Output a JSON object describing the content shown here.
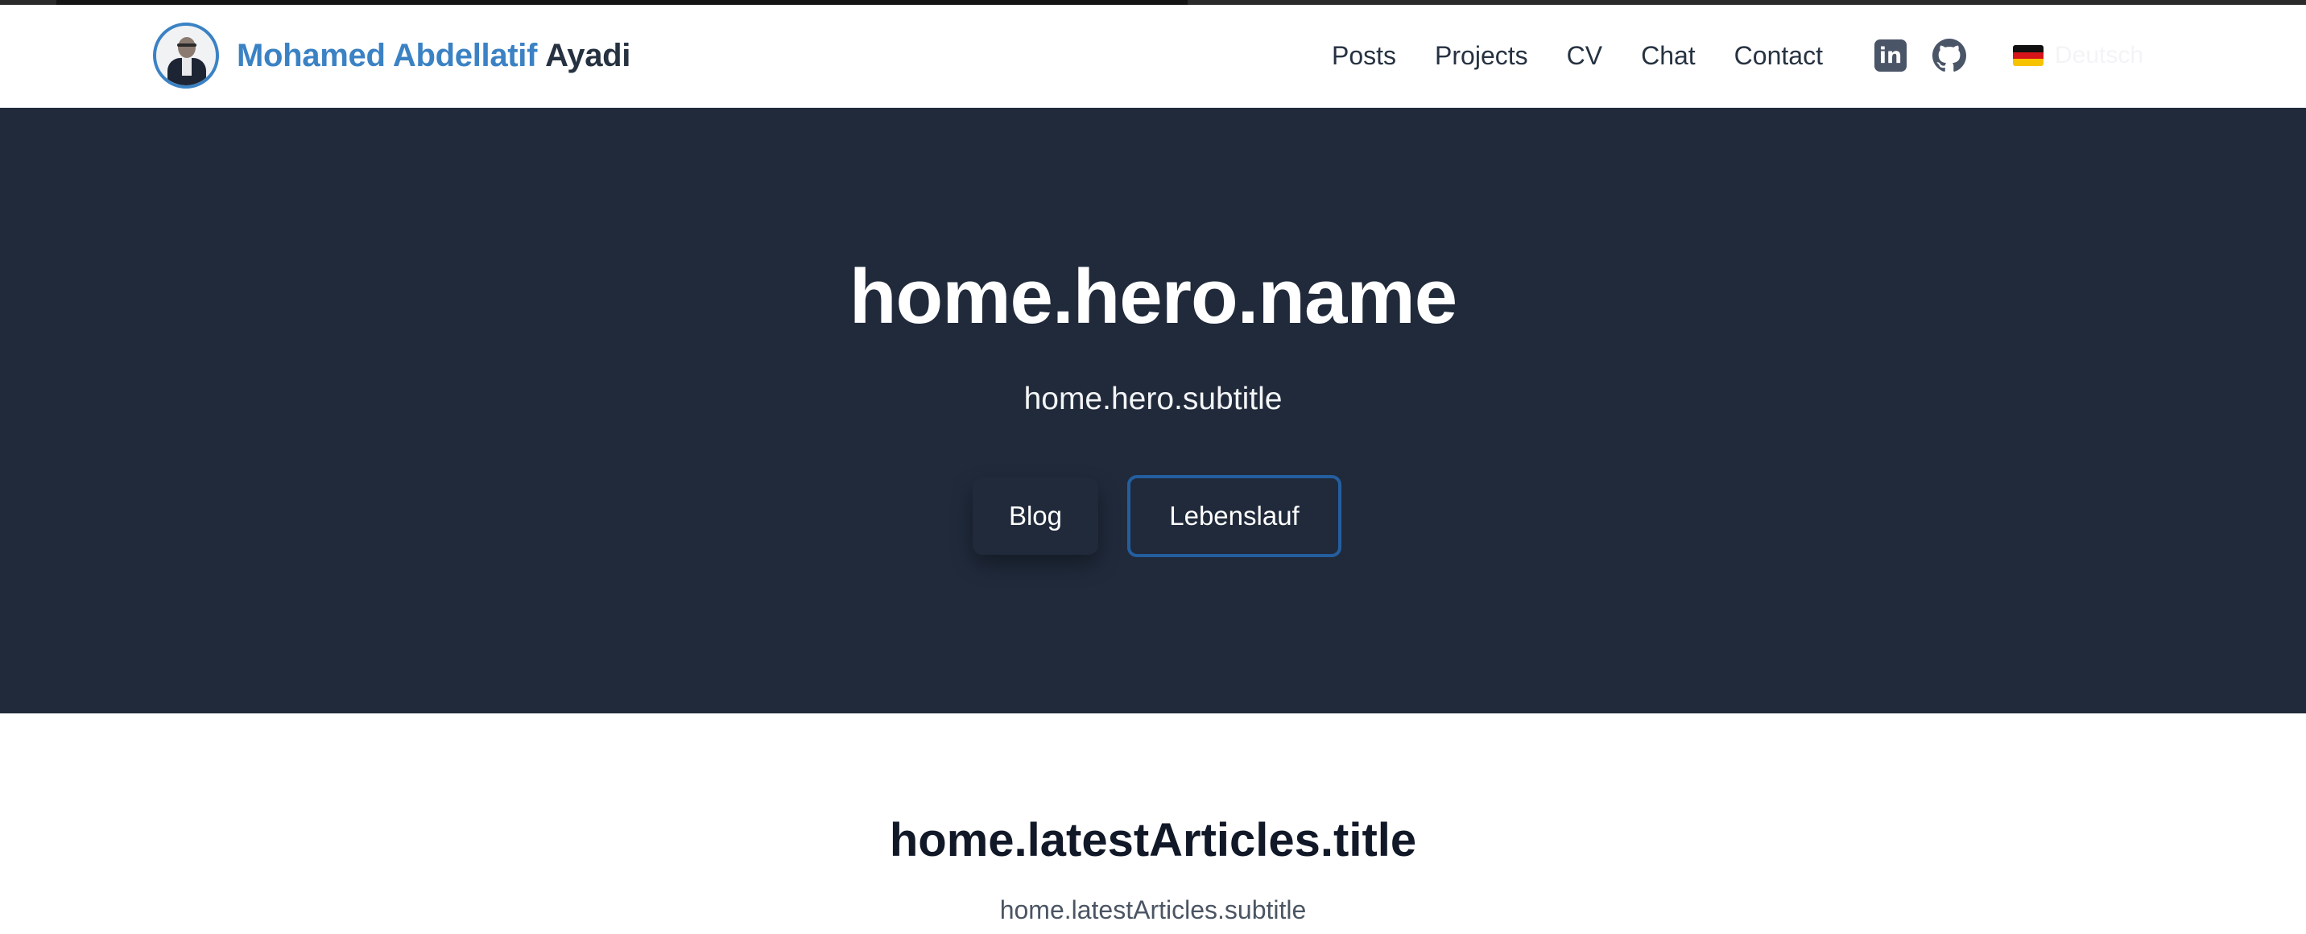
{
  "brand": {
    "first_name": "Mohamed Abdellatif",
    "last_name": "Ayadi"
  },
  "nav": {
    "items": [
      {
        "label": "Posts"
      },
      {
        "label": "Projects"
      },
      {
        "label": "CV"
      },
      {
        "label": "Chat"
      },
      {
        "label": "Contact"
      }
    ],
    "social": {
      "linkedin_icon": "linkedin-icon",
      "linkedin_glyph": "in",
      "github_icon": "github-icon"
    },
    "language": {
      "flag_icon": "german-flag-icon",
      "label": "Deutsch"
    }
  },
  "hero": {
    "title": "home.hero.name",
    "subtitle": "home.hero.subtitle",
    "primary_button": "Blog",
    "secondary_button": "Lebenslauf"
  },
  "latest": {
    "title": "home.latestArticles.title",
    "subtitle": "home.latestArticles.subtitle"
  },
  "colors": {
    "accent": "#3b82c4",
    "hero_bg": "#202a3b",
    "button_border": "#245e9e",
    "text_dark": "#263241"
  }
}
